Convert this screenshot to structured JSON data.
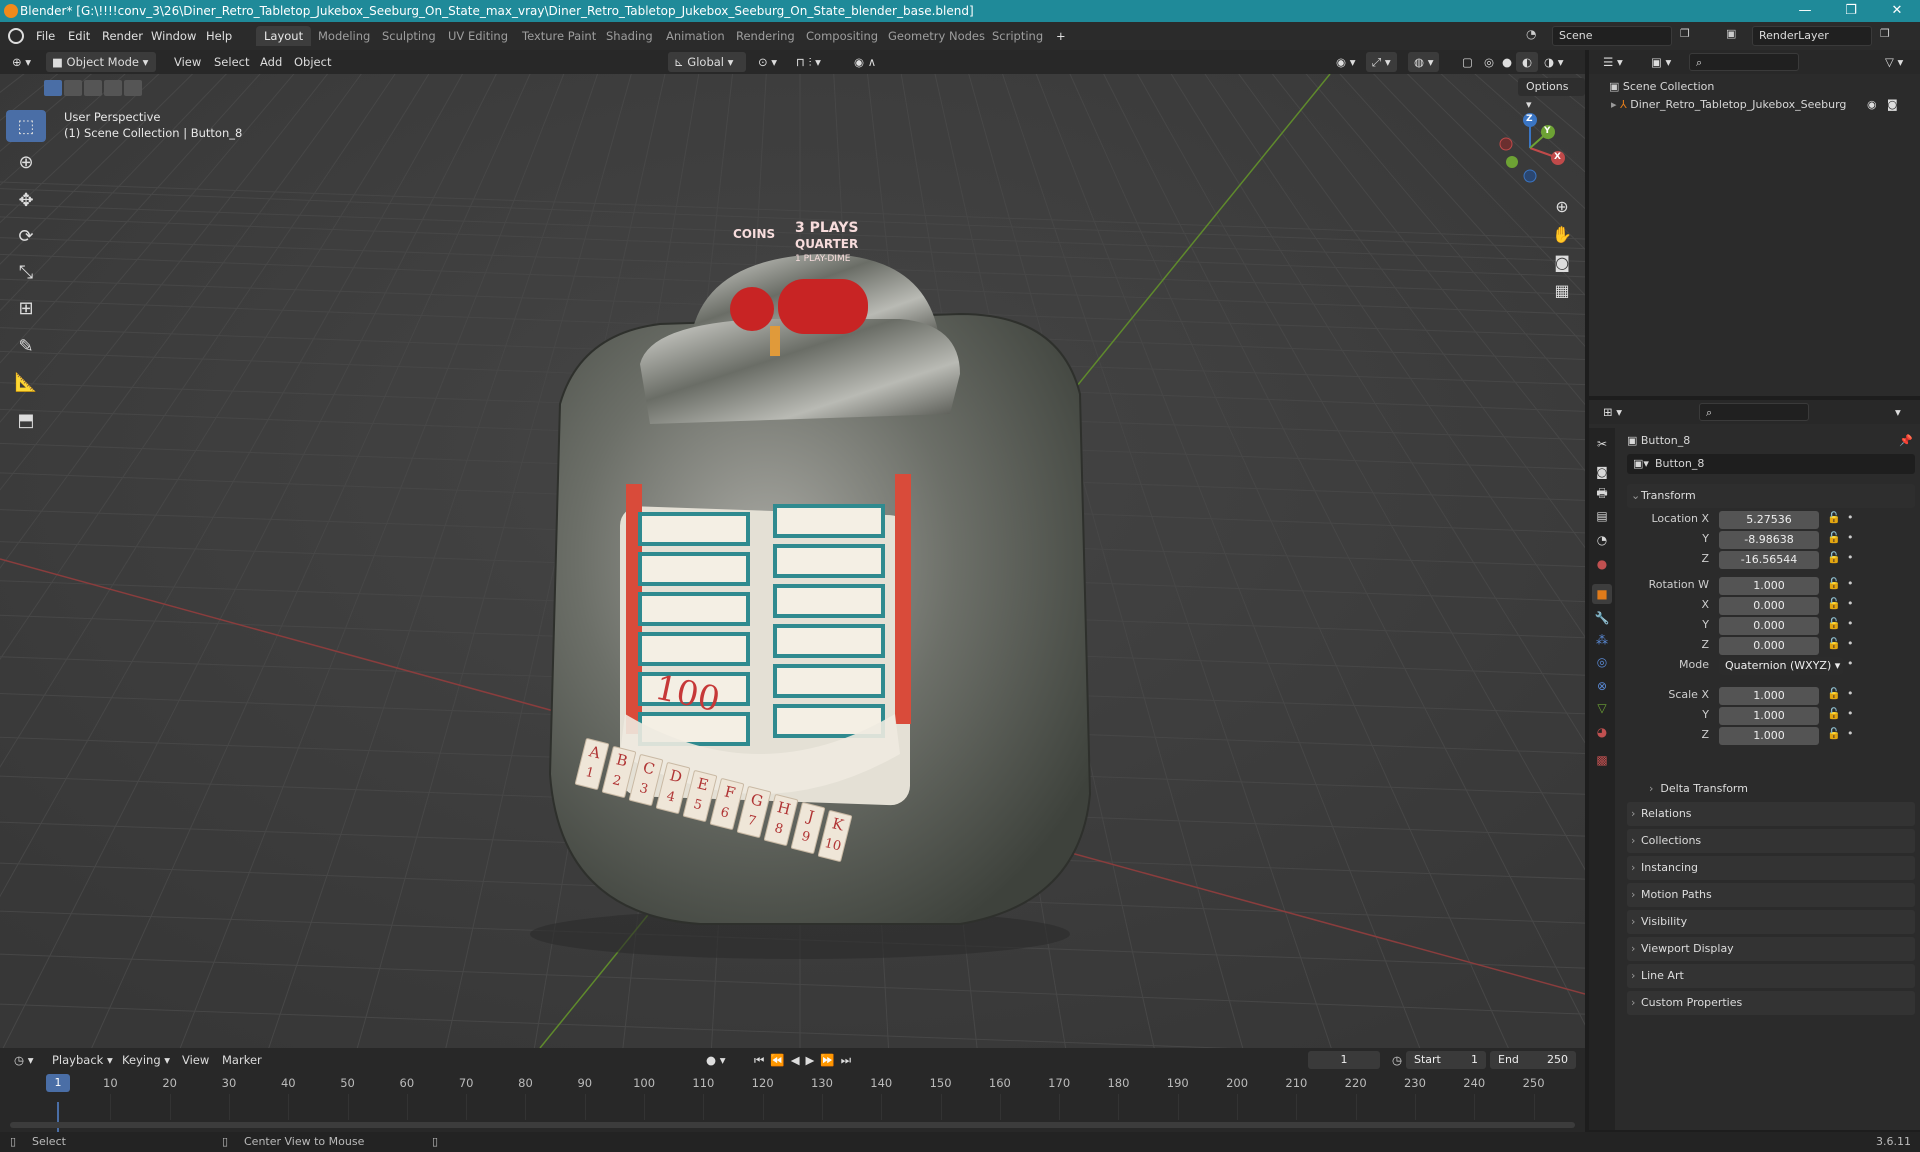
{
  "titlebar": {
    "title": "Blender* [G:\\!!!!conv_3\\26\\Diner_Retro_Tabletop_Jukebox_Seeburg_On_State_max_vray\\Diner_Retro_Tabletop_Jukebox_Seeburg_On_State_blender_base.blend]",
    "minimize": "—",
    "maximize": "❐",
    "close": "✕"
  },
  "menu": {
    "items": [
      "File",
      "Edit",
      "Render",
      "Window",
      "Help"
    ],
    "workspaces": [
      "Layout",
      "Modeling",
      "Sculpting",
      "UV Editing",
      "Texture Paint",
      "Shading",
      "Animation",
      "Rendering",
      "Compositing",
      "Geometry Nodes",
      "Scripting"
    ],
    "add_tab": "+",
    "scene": "Scene",
    "render_layer": "RenderLayer"
  },
  "viewport_header": {
    "mode": "Object Mode",
    "menus": [
      "View",
      "Select",
      "Add",
      "Object"
    ],
    "orientation": "Global",
    "options": "Options"
  },
  "viewport": {
    "perspective": "User Perspective",
    "collection_info": "(1) Scene Collection | Button_8",
    "gizmo_axes": [
      "X",
      "Y",
      "Z"
    ]
  },
  "outliner": {
    "root": "Scene Collection",
    "items": [
      {
        "name": "Diner_Retro_Tabletop_Jukebox_Seeburg"
      }
    ]
  },
  "properties": {
    "object_name": "Button_8",
    "object_field": "Button_8",
    "transform_label": "Transform",
    "location": {
      "label": "Location X",
      "x": "5.27536",
      "y": "-8.98638",
      "z": "-16.56544"
    },
    "rotation": {
      "label": "Rotation W",
      "w": "1.000",
      "x": "0.000",
      "y": "0.000",
      "z": "0.000"
    },
    "mode": {
      "label": "Mode",
      "value": "Quaternion (WXYZ)"
    },
    "scale": {
      "label": "Scale X",
      "x": "1.000",
      "y": "1.000",
      "z": "1.000"
    },
    "axis_labels": {
      "y": "Y",
      "z": "Z",
      "x": "X"
    },
    "delta": "Delta Transform",
    "sections": [
      "Relations",
      "Collections",
      "Instancing",
      "Motion Paths",
      "Visibility",
      "Viewport Display",
      "Line Art",
      "Custom Properties"
    ]
  },
  "timeline": {
    "menus": [
      "Playback",
      "Keying",
      "View",
      "Marker"
    ],
    "current_frame": "1",
    "start_label": "Start",
    "start": "1",
    "end_label": "End",
    "end": "250",
    "ticks": [
      "10",
      "20",
      "30",
      "40",
      "50",
      "60",
      "70",
      "80",
      "90",
      "100",
      "110",
      "120",
      "130",
      "140",
      "150",
      "160",
      "170",
      "180",
      "190",
      "200",
      "210",
      "220",
      "230",
      "240",
      "250"
    ],
    "playhead": "1"
  },
  "statusbar": {
    "select": "Select",
    "center": "Center View to Mouse",
    "version": "3.6.11"
  },
  "jukebox": {
    "coins": "COINS",
    "plays": "3 PLAYS",
    "quarter": "QUARTER",
    "playdime": "1 PLAY-DIME",
    "letters": [
      "A",
      "B",
      "C",
      "D",
      "E",
      "F",
      "G",
      "H",
      "J",
      "K"
    ],
    "numbers": [
      "1",
      "2",
      "3",
      "4",
      "5",
      "6",
      "7",
      "8",
      "9",
      "10"
    ],
    "hundred": "100"
  },
  "colors": {
    "title_bg": "#1f8a99",
    "accent": "#4a6ea6",
    "x_axis": "#c04a4a",
    "y_axis": "#6da234",
    "z_axis": "#3a75c4",
    "orange": "#e07b1a"
  }
}
